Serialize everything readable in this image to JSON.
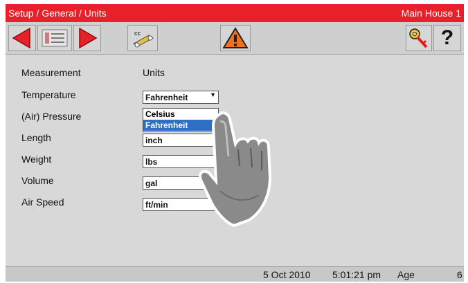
{
  "title_bar": {
    "breadcrumb": "Setup / General / Units",
    "location": "Main House 1"
  },
  "toolbar": {
    "cc_label": "cc",
    "help_label": "?"
  },
  "columns": {
    "measurement": "Measurement",
    "units": "Units"
  },
  "rows": [
    {
      "label": "Temperature",
      "value": "Fahrenheit"
    },
    {
      "label": "(Air) Pressure",
      "value": ""
    },
    {
      "label": "Length",
      "value": "inch"
    },
    {
      "label": "Weight",
      "value": "lbs"
    },
    {
      "label": "Volume",
      "value": "gal"
    },
    {
      "label": "Air Speed",
      "value": "ft/min"
    }
  ],
  "temperature_dropdown": {
    "options": [
      "Celsius",
      "Fahrenheit"
    ],
    "selected": "Fahrenheit"
  },
  "status_bar": {
    "date": "5 Oct 2010",
    "time": "5:01:21 pm",
    "age_label": "Age",
    "age_value": "6"
  },
  "colors": {
    "title_bar": "#e8202a",
    "nav_arrow": "#e8202a",
    "warning": "#f07020",
    "selection": "#2f6fc8"
  }
}
